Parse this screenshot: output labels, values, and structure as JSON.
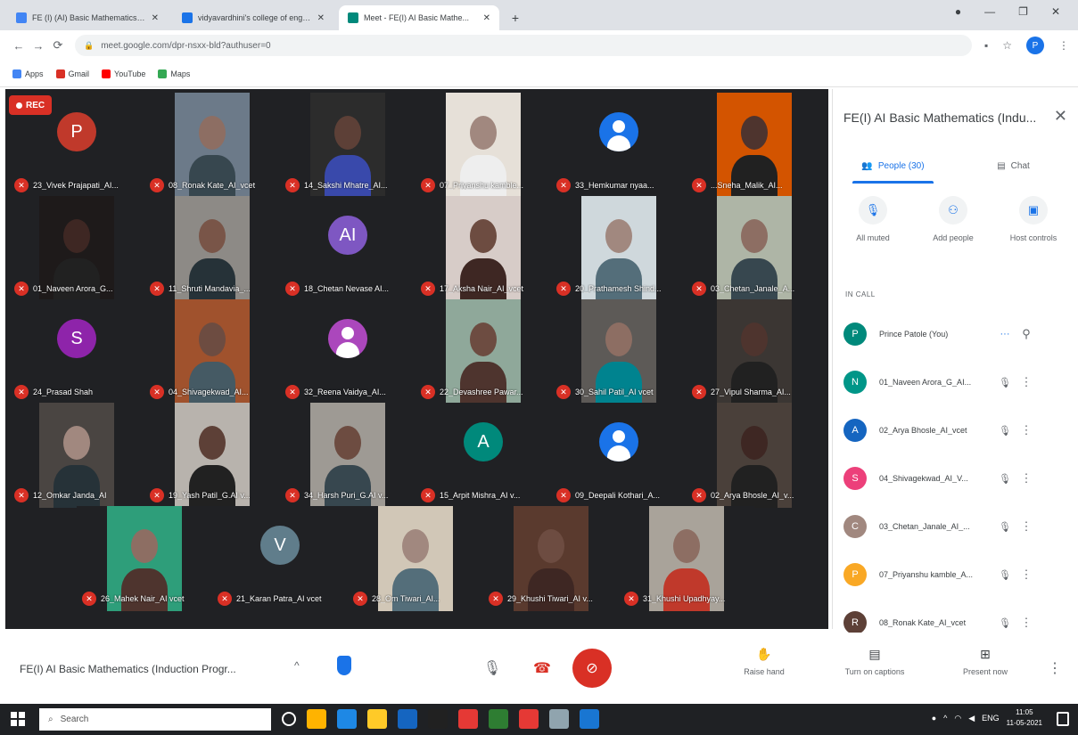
{
  "browser": {
    "tabs": [
      {
        "title": "FE (I) (AI) Basic Mathematics Ind...",
        "favicon_color": "#4285f4",
        "active": false
      },
      {
        "title": "vidyavardhini's college of engin...",
        "favicon_color": "#1a73e8",
        "active": false
      },
      {
        "title": "Meet - FE(I) AI Basic Mathe...",
        "favicon_color": "#00897b",
        "active": true
      }
    ],
    "new_tab": "+",
    "url": "meet.google.com/dpr-nsxx-bld?authuser=0",
    "bookmarks": [
      {
        "label": "Apps",
        "color": "#4285f4"
      },
      {
        "label": "Gmail",
        "color": "#d93025"
      },
      {
        "label": "YouTube",
        "color": "#ff0000"
      },
      {
        "label": "Maps",
        "color": "#34a853"
      }
    ],
    "profile_letter": "P"
  },
  "meet": {
    "rec_label": "REC",
    "tiles": [
      {
        "name": "23_Vivek Prajapati_AI...",
        "type": "letter",
        "letter": "P",
        "color": "#c0392b"
      },
      {
        "name": "08_Ronak Kate_AI_vcet",
        "type": "photo",
        "bg": "#6c7a89",
        "skin": "#8d6e63",
        "shirt": "#37474f"
      },
      {
        "name": "14_Sakshi Mhatre_AI...",
        "type": "photo",
        "bg": "#2c2c2c",
        "skin": "#5d4037",
        "shirt": "#3949ab"
      },
      {
        "name": "07_Priyanshu kamble...",
        "type": "photo",
        "bg": "#e6e0d8",
        "skin": "#a1887f",
        "shirt": "#eeeeee"
      },
      {
        "name": "33_Hemkumar nyaa...",
        "type": "generic"
      },
      {
        "name": "...Sneha_Malik_AI...",
        "type": "photo",
        "bg": "#d35400",
        "skin": "#4e342e",
        "shirt": "#212121"
      },
      {
        "name": "01_Naveen Arora_G...",
        "type": "photo",
        "bg": "#1e1a1a",
        "skin": "#3e2723",
        "shirt": "#212121"
      },
      {
        "name": "11_Shruti Mandavia_...",
        "type": "photo",
        "bg": "#8d8a86",
        "skin": "#795548",
        "shirt": "#263238"
      },
      {
        "name": "18_Chetan Nevase AI...",
        "type": "letter",
        "letter": "AI",
        "color": "#7e57c2"
      },
      {
        "name": "17_Aksha Nair_AI_vcet",
        "type": "photo",
        "bg": "#d7ccc8",
        "skin": "#6d4c41",
        "shirt": "#3e2723"
      },
      {
        "name": "20_Prathamesh Shind...",
        "type": "photo",
        "bg": "#cfd8dc",
        "skin": "#a1887f",
        "shirt": "#546e7a"
      },
      {
        "name": "03_Chetan_Janale_A...",
        "type": "photo",
        "bg": "#aeb5a6",
        "skin": "#8d6e63",
        "shirt": "#37474f"
      },
      {
        "name": "24_Prasad Shah",
        "type": "letter",
        "letter": "S",
        "color": "#8e24aa"
      },
      {
        "name": "04_Shivagekwad_AI...",
        "type": "photo",
        "bg": "#a0522d",
        "skin": "#6d4c41",
        "shirt": "#455a64"
      },
      {
        "name": "32_Reena Vaidya_AI...",
        "type": "generic_purple"
      },
      {
        "name": "22_Devashree Pawar...",
        "type": "photo",
        "bg": "#8fa89a",
        "skin": "#6d4c41",
        "shirt": "#4e342e"
      },
      {
        "name": "30_Sahil Patil_AI vcet",
        "type": "photo",
        "bg": "#5d5a57",
        "skin": "#8d6e63",
        "shirt": "#00838f"
      },
      {
        "name": "27_Vipul Sharma_AI...",
        "type": "photo",
        "bg": "#3b3633",
        "skin": "#4e342e",
        "shirt": "#212121"
      },
      {
        "name": "12_Omkar Janda_AI",
        "type": "photo",
        "bg": "#4a4542",
        "skin": "#a1887f",
        "shirt": "#263238"
      },
      {
        "name": "19_Yash Patil_G.AI v...",
        "type": "photo",
        "bg": "#b8b3ad",
        "skin": "#5d4037",
        "shirt": "#212121"
      },
      {
        "name": "34_Harsh Puri_G.AI v...",
        "type": "photo",
        "bg": "#9e9a94",
        "skin": "#6d4c41",
        "shirt": "#37474f"
      },
      {
        "name": "15_Arpit Mishra_AI v...",
        "type": "letter",
        "letter": "A",
        "color": "#00897b"
      },
      {
        "name": "09_Deepali Kothari_A...",
        "type": "generic"
      },
      {
        "name": "02_Arya Bhosle_AI_v...",
        "type": "photo",
        "bg": "#4a403a",
        "skin": "#3e2723",
        "shirt": "#212121"
      },
      {
        "name": "26_Mahek Nair_AI vcet",
        "type": "photo",
        "bg": "#2e9e7a",
        "skin": "#8d6e63",
        "shirt": "#4e342e"
      },
      {
        "name": "21_Karan Patra_AI vcet",
        "type": "letter",
        "letter": "V",
        "color": "#607d8b"
      },
      {
        "name": "28_Om Tiwari_AI...",
        "type": "photo",
        "bg": "#d1c7b7",
        "skin": "#a1887f",
        "shirt": "#546e7a"
      },
      {
        "name": "29_Khushi Tiwari_AI v...",
        "type": "photo",
        "bg": "#5a3a2e",
        "skin": "#6d4c41",
        "shirt": "#3e2723"
      },
      {
        "name": "31_Khushi Upadhyay...",
        "type": "photo",
        "bg": "#a9a39a",
        "skin": "#8d6e63",
        "shirt": "#c0392b"
      }
    ]
  },
  "panel": {
    "title": "FE(I) AI Basic Mathematics (Indu...",
    "tab_people": "People (30)",
    "tab_chat": "Chat",
    "actions": [
      {
        "label": "All muted",
        "icon": "mic-off-icon",
        "glyph": "🎙"
      },
      {
        "label": "Add people",
        "icon": "add-person-icon",
        "glyph": "⚇"
      },
      {
        "label": "Host controls",
        "icon": "host-controls-icon",
        "glyph": "▣"
      }
    ],
    "section_label": "IN CALL",
    "people": [
      {
        "name": "Prince Patole (You)",
        "letter": "P",
        "color": "#00897b",
        "you": true
      },
      {
        "name": "01_Naveen Arora_G_AI...",
        "letter": "N",
        "color": "#009688",
        "you": false
      },
      {
        "name": "02_Arya Bhosle_AI_vcet",
        "letter": "A",
        "color": "#1565c0",
        "you": false
      },
      {
        "name": "04_Shivagekwad_AI_V...",
        "letter": "S",
        "color": "#ec407a",
        "you": false
      },
      {
        "name": "03_Chetan_Janale_AI_...",
        "letter": "C",
        "color": "#a1887f",
        "you": false
      },
      {
        "name": "07_Priyanshu kamble_A...",
        "letter": "P",
        "color": "#f9a825",
        "you": false
      },
      {
        "name": "08_Ronak Kate_AI_vcet",
        "letter": "R",
        "color": "#5d4037",
        "you": false
      }
    ]
  },
  "bottom": {
    "meeting_title": "FE(I) AI Basic Mathematics (Induction Progr...",
    "raise_hand": "Raise hand",
    "captions": "Turn on captions",
    "present": "Present now"
  },
  "taskbar": {
    "search_placeholder": "Search",
    "time": "11:05",
    "date": "11-05-2021",
    "lang": "ENG",
    "apps": [
      "#ffffff",
      "#ffb300",
      "#1e88e5",
      "#ffca28",
      "#1565c0",
      "#212121",
      "#e53935",
      "#2e7d32",
      "#e53935",
      "#90a4ae",
      "#1976d2"
    ]
  }
}
